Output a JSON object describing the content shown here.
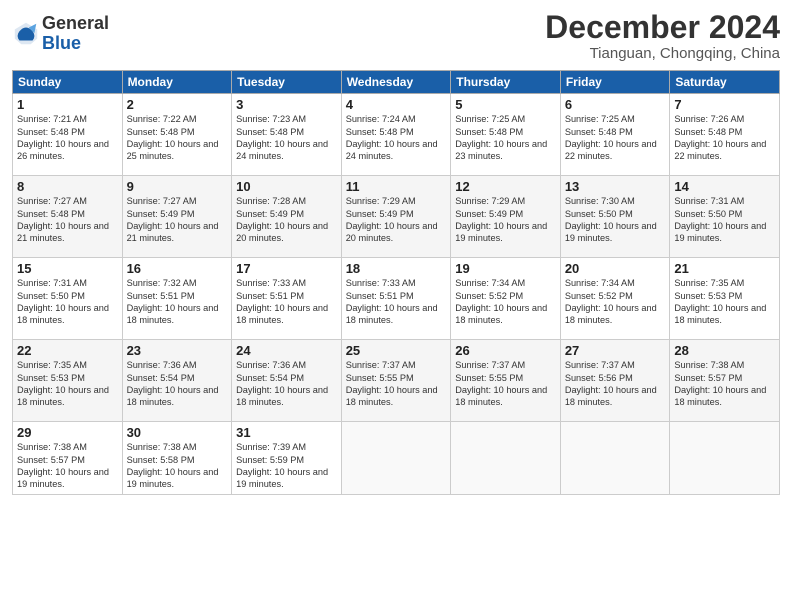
{
  "header": {
    "logo_general": "General",
    "logo_blue": "Blue",
    "month_title": "December 2024",
    "location": "Tianguan, Chongqing, China"
  },
  "columns": [
    "Sunday",
    "Monday",
    "Tuesday",
    "Wednesday",
    "Thursday",
    "Friday",
    "Saturday"
  ],
  "weeks": [
    [
      {
        "day": "1",
        "sunrise": "7:21 AM",
        "sunset": "5:48 PM",
        "daylight": "10 hours and 26 minutes."
      },
      {
        "day": "2",
        "sunrise": "7:22 AM",
        "sunset": "5:48 PM",
        "daylight": "10 hours and 25 minutes."
      },
      {
        "day": "3",
        "sunrise": "7:23 AM",
        "sunset": "5:48 PM",
        "daylight": "10 hours and 24 minutes."
      },
      {
        "day": "4",
        "sunrise": "7:24 AM",
        "sunset": "5:48 PM",
        "daylight": "10 hours and 24 minutes."
      },
      {
        "day": "5",
        "sunrise": "7:25 AM",
        "sunset": "5:48 PM",
        "daylight": "10 hours and 23 minutes."
      },
      {
        "day": "6",
        "sunrise": "7:25 AM",
        "sunset": "5:48 PM",
        "daylight": "10 hours and 22 minutes."
      },
      {
        "day": "7",
        "sunrise": "7:26 AM",
        "sunset": "5:48 PM",
        "daylight": "10 hours and 22 minutes."
      }
    ],
    [
      {
        "day": "8",
        "sunrise": "7:27 AM",
        "sunset": "5:48 PM",
        "daylight": "10 hours and 21 minutes."
      },
      {
        "day": "9",
        "sunrise": "7:27 AM",
        "sunset": "5:49 PM",
        "daylight": "10 hours and 21 minutes."
      },
      {
        "day": "10",
        "sunrise": "7:28 AM",
        "sunset": "5:49 PM",
        "daylight": "10 hours and 20 minutes."
      },
      {
        "day": "11",
        "sunrise": "7:29 AM",
        "sunset": "5:49 PM",
        "daylight": "10 hours and 20 minutes."
      },
      {
        "day": "12",
        "sunrise": "7:29 AM",
        "sunset": "5:49 PM",
        "daylight": "10 hours and 19 minutes."
      },
      {
        "day": "13",
        "sunrise": "7:30 AM",
        "sunset": "5:50 PM",
        "daylight": "10 hours and 19 minutes."
      },
      {
        "day": "14",
        "sunrise": "7:31 AM",
        "sunset": "5:50 PM",
        "daylight": "10 hours and 19 minutes."
      }
    ],
    [
      {
        "day": "15",
        "sunrise": "7:31 AM",
        "sunset": "5:50 PM",
        "daylight": "10 hours and 18 minutes."
      },
      {
        "day": "16",
        "sunrise": "7:32 AM",
        "sunset": "5:51 PM",
        "daylight": "10 hours and 18 minutes."
      },
      {
        "day": "17",
        "sunrise": "7:33 AM",
        "sunset": "5:51 PM",
        "daylight": "10 hours and 18 minutes."
      },
      {
        "day": "18",
        "sunrise": "7:33 AM",
        "sunset": "5:51 PM",
        "daylight": "10 hours and 18 minutes."
      },
      {
        "day": "19",
        "sunrise": "7:34 AM",
        "sunset": "5:52 PM",
        "daylight": "10 hours and 18 minutes."
      },
      {
        "day": "20",
        "sunrise": "7:34 AM",
        "sunset": "5:52 PM",
        "daylight": "10 hours and 18 minutes."
      },
      {
        "day": "21",
        "sunrise": "7:35 AM",
        "sunset": "5:53 PM",
        "daylight": "10 hours and 18 minutes."
      }
    ],
    [
      {
        "day": "22",
        "sunrise": "7:35 AM",
        "sunset": "5:53 PM",
        "daylight": "10 hours and 18 minutes."
      },
      {
        "day": "23",
        "sunrise": "7:36 AM",
        "sunset": "5:54 PM",
        "daylight": "10 hours and 18 minutes."
      },
      {
        "day": "24",
        "sunrise": "7:36 AM",
        "sunset": "5:54 PM",
        "daylight": "10 hours and 18 minutes."
      },
      {
        "day": "25",
        "sunrise": "7:37 AM",
        "sunset": "5:55 PM",
        "daylight": "10 hours and 18 minutes."
      },
      {
        "day": "26",
        "sunrise": "7:37 AM",
        "sunset": "5:55 PM",
        "daylight": "10 hours and 18 minutes."
      },
      {
        "day": "27",
        "sunrise": "7:37 AM",
        "sunset": "5:56 PM",
        "daylight": "10 hours and 18 minutes."
      },
      {
        "day": "28",
        "sunrise": "7:38 AM",
        "sunset": "5:57 PM",
        "daylight": "10 hours and 18 minutes."
      }
    ],
    [
      {
        "day": "29",
        "sunrise": "7:38 AM",
        "sunset": "5:57 PM",
        "daylight": "10 hours and 19 minutes."
      },
      {
        "day": "30",
        "sunrise": "7:38 AM",
        "sunset": "5:58 PM",
        "daylight": "10 hours and 19 minutes."
      },
      {
        "day": "31",
        "sunrise": "7:39 AM",
        "sunset": "5:59 PM",
        "daylight": "10 hours and 19 minutes."
      },
      null,
      null,
      null,
      null
    ]
  ]
}
